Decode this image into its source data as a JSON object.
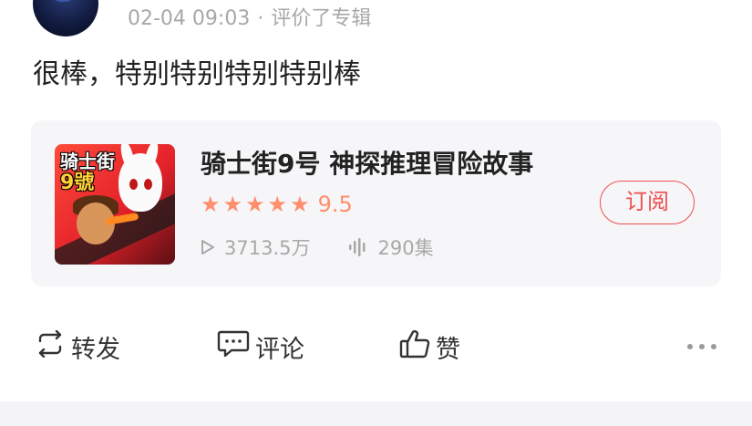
{
  "post": {
    "timestamp": "02-04 09:03",
    "separator": "·",
    "action_text": "评价了专辑",
    "comment": "很棒，特别特别特别特别棒"
  },
  "album": {
    "title": "骑士街9号 神探推理冒险故事",
    "cover_title": "骑士街",
    "cover_number": "9號",
    "rating_stars": 5,
    "rating": "9.5",
    "plays": "3713.5万",
    "episodes": "290集",
    "subscribe_label": "订阅"
  },
  "actions": {
    "forward_label": "转发",
    "comment_label": "评论",
    "like_label": "赞"
  },
  "colors": {
    "accent_red": "#ee4f4f",
    "star_orange": "#ff8e6c",
    "meta_gray": "#a8a8a8",
    "card_bg": "#f6f6f8"
  },
  "icons": {
    "forward": "forward-icon",
    "comment": "comment-icon",
    "like": "thumbs-up-icon",
    "more": "more-icon",
    "play": "play-icon",
    "audio": "audio-wave-icon"
  }
}
